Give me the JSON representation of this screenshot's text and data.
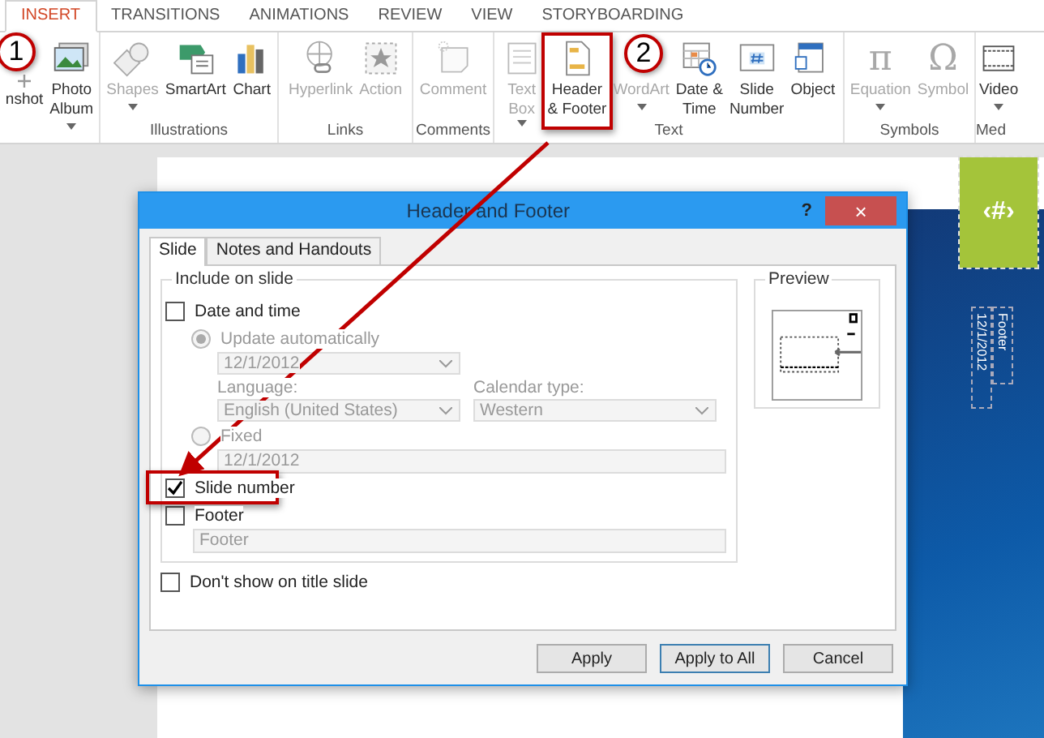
{
  "ribbon": {
    "tabs": [
      {
        "label": "INSERT",
        "selected": true
      },
      {
        "label": "TRANSITIONS",
        "selected": false
      },
      {
        "label": "ANIMATIONS",
        "selected": false
      },
      {
        "label": "REVIEW",
        "selected": false
      },
      {
        "label": "VIEW",
        "selected": false
      },
      {
        "label": "STORYBOARDING",
        "selected": false
      }
    ],
    "groups": [
      {
        "buttons": [
          {
            "kind": "screenshot",
            "lines": [
              "nshot"
            ],
            "disabled": false,
            "dropdown": false
          },
          {
            "kind": "album",
            "lines": [
              "Photo",
              "Album"
            ],
            "disabled": false,
            "dropdown": true
          }
        ]
      },
      {
        "label": "Illustrations",
        "buttons": [
          {
            "kind": "shapes",
            "lines": [
              "Shapes"
            ],
            "disabled": true,
            "dropdown": true
          },
          {
            "kind": "smartart",
            "lines": [
              "SmartArt"
            ],
            "disabled": false,
            "dropdown": false
          },
          {
            "kind": "chart",
            "lines": [
              "Chart"
            ],
            "disabled": false,
            "dropdown": false
          }
        ]
      },
      {
        "label": "Links",
        "buttons": [
          {
            "kind": "hyperlink",
            "lines": [
              "Hyperlink"
            ],
            "disabled": true,
            "dropdown": false
          },
          {
            "kind": "action",
            "lines": [
              "Action"
            ],
            "disabled": true,
            "dropdown": false
          }
        ]
      },
      {
        "label": "Comments",
        "buttons": [
          {
            "kind": "comment",
            "lines": [
              "Comment"
            ],
            "disabled": true,
            "dropdown": false
          }
        ]
      },
      {
        "label": "Text",
        "buttons": [
          {
            "kind": "textbox",
            "lines": [
              "Text",
              "Box"
            ],
            "disabled": true,
            "dropdown": true
          },
          {
            "kind": "header",
            "lines": [
              "Header",
              "& Footer"
            ],
            "disabled": false,
            "dropdown": false
          },
          {
            "kind": "wordart",
            "lines": [
              "WordArt"
            ],
            "disabled": true,
            "dropdown": true
          },
          {
            "kind": "datetime",
            "lines": [
              "Date &",
              "Time"
            ],
            "disabled": false,
            "dropdown": false
          },
          {
            "kind": "slidenum",
            "lines": [
              "Slide",
              "Number"
            ],
            "disabled": false,
            "dropdown": false
          },
          {
            "kind": "object",
            "lines": [
              "Object"
            ],
            "disabled": false,
            "dropdown": false
          }
        ]
      },
      {
        "label": "Symbols",
        "buttons": [
          {
            "kind": "glyph",
            "glyph": "π",
            "lines": [
              "Equation"
            ],
            "disabled": true,
            "dropdown": true
          },
          {
            "kind": "glyph",
            "glyph": "Ω",
            "lines": [
              "Symbol"
            ],
            "disabled": true,
            "dropdown": false
          }
        ]
      },
      {
        "label": "Med",
        "buttons": [
          {
            "kind": "video",
            "lines": [
              "Video"
            ],
            "disabled": false,
            "dropdown": true
          }
        ]
      }
    ]
  },
  "slide": {
    "number_placeholder": "‹#›",
    "footer_placeholder": "Footer",
    "date_placeholder": "12/1/2012"
  },
  "dialog": {
    "title": "Header and Footer",
    "help": "?",
    "close": "×",
    "tabs": [
      {
        "label": "Slide",
        "selected": true
      },
      {
        "label": "Notes and Handouts",
        "selected": false
      }
    ],
    "group_title": "Include on slide",
    "date_time": {
      "label": "Date and time",
      "checked": false
    },
    "update_auto": {
      "label": "Update automatically",
      "selected": true,
      "disabled": true
    },
    "date_format": "12/1/2012",
    "language": {
      "label": "Language:",
      "value": "English (United States)"
    },
    "calendar": {
      "label": "Calendar type:",
      "value": "Western"
    },
    "fixed": {
      "label": "Fixed",
      "selected": false,
      "disabled": true
    },
    "fixed_value": "12/1/2012",
    "slide_number": {
      "label": "Slide number",
      "checked": true
    },
    "footer": {
      "label": "Footer",
      "checked": false,
      "value": "Footer"
    },
    "dont_show": {
      "label": "Don't show on title slide",
      "checked": false
    },
    "preview_title": "Preview",
    "buttons": [
      "Apply",
      "Apply to All",
      "Cancel"
    ]
  },
  "callouts": [
    "1",
    "2"
  ]
}
